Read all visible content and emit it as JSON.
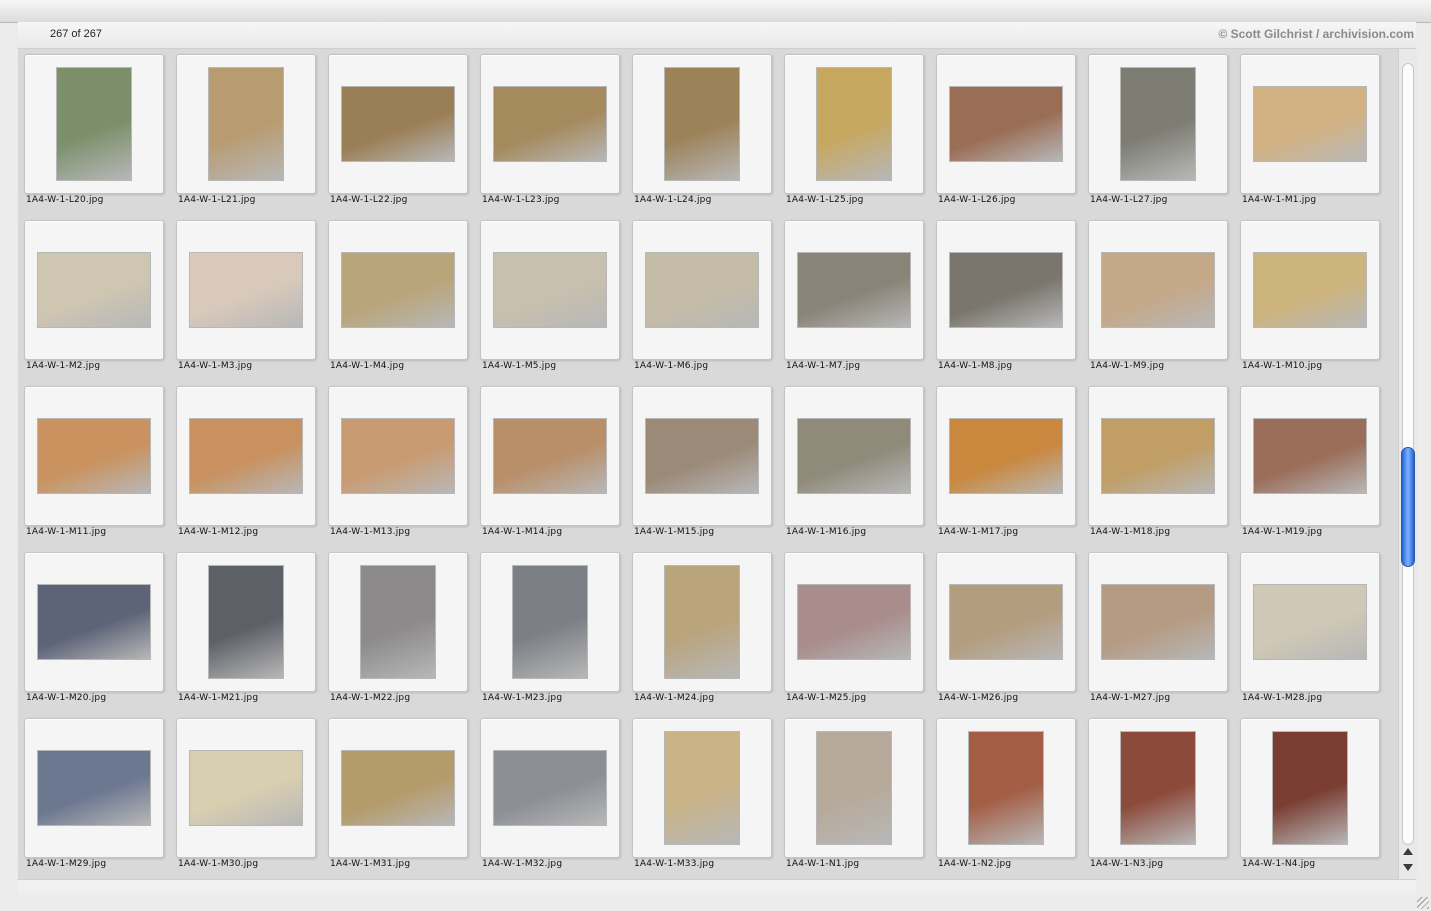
{
  "header": {
    "count": "267 of 267",
    "credit": "© Scott Gilchrist / archivision.com"
  },
  "thumbnails": [
    {
      "file": "1A4-W-1-L20.jpg",
      "orient": "portrait",
      "color": "#7a8f6a"
    },
    {
      "file": "1A4-W-1-L21.jpg",
      "orient": "portrait",
      "color": "#b89b70"
    },
    {
      "file": "1A4-W-1-L22.jpg",
      "orient": "landscape",
      "color": "#9a7e55"
    },
    {
      "file": "1A4-W-1-L23.jpg",
      "orient": "landscape",
      "color": "#a58a5e"
    },
    {
      "file": "1A4-W-1-L24.jpg",
      "orient": "portrait",
      "color": "#9c8259"
    },
    {
      "file": "1A4-W-1-L25.jpg",
      "orient": "portrait",
      "color": "#c6a75f"
    },
    {
      "file": "1A4-W-1-L26.jpg",
      "orient": "landscape",
      "color": "#9a6d55"
    },
    {
      "file": "1A4-W-1-L27.jpg",
      "orient": "portrait",
      "color": "#7d7d74"
    },
    {
      "file": "1A4-W-1-M1.jpg",
      "orient": "landscape",
      "color": "#d2b283"
    },
    {
      "file": "1A4-W-1-M2.jpg",
      "orient": "landscape",
      "color": "#cfc6b2"
    },
    {
      "file": "1A4-W-1-M3.jpg",
      "orient": "landscape",
      "color": "#d8c9bb"
    },
    {
      "file": "1A4-W-1-M4.jpg",
      "orient": "landscape",
      "color": "#b9a57a"
    },
    {
      "file": "1A4-W-1-M5.jpg",
      "orient": "landscape",
      "color": "#c8c0ae"
    },
    {
      "file": "1A4-W-1-M6.jpg",
      "orient": "landscape",
      "color": "#c5bca7"
    },
    {
      "file": "1A4-W-1-M7.jpg",
      "orient": "landscape",
      "color": "#8a8478"
    },
    {
      "file": "1A4-W-1-M8.jpg",
      "orient": "landscape",
      "color": "#7a766d"
    },
    {
      "file": "1A4-W-1-M9.jpg",
      "orient": "landscape",
      "color": "#c5a888"
    },
    {
      "file": "1A4-W-1-M10.jpg",
      "orient": "landscape",
      "color": "#cdb47d"
    },
    {
      "file": "1A4-W-1-M11.jpg",
      "orient": "landscape",
      "color": "#c9925f"
    },
    {
      "file": "1A4-W-1-M12.jpg",
      "orient": "landscape",
      "color": "#c8915f"
    },
    {
      "file": "1A4-W-1-M13.jpg",
      "orient": "landscape",
      "color": "#c99b72"
    },
    {
      "file": "1A4-W-1-M14.jpg",
      "orient": "landscape",
      "color": "#b98f6a"
    },
    {
      "file": "1A4-W-1-M15.jpg",
      "orient": "landscape",
      "color": "#9b8a78"
    },
    {
      "file": "1A4-W-1-M16.jpg",
      "orient": "landscape",
      "color": "#8f8a7a"
    },
    {
      "file": "1A4-W-1-M17.jpg",
      "orient": "landscape",
      "color": "#c9883e"
    },
    {
      "file": "1A4-W-1-M18.jpg",
      "orient": "landscape",
      "color": "#c09e66"
    },
    {
      "file": "1A4-W-1-M19.jpg",
      "orient": "landscape",
      "color": "#9b6e5a"
    },
    {
      "file": "1A4-W-1-M20.jpg",
      "orient": "landscape",
      "color": "#5d6478"
    },
    {
      "file": "1A4-W-1-M21.jpg",
      "orient": "portrait",
      "color": "#5e6068"
    },
    {
      "file": "1A4-W-1-M22.jpg",
      "orient": "portrait",
      "color": "#8c8a8a"
    },
    {
      "file": "1A4-W-1-M23.jpg",
      "orient": "portrait",
      "color": "#7c7f86"
    },
    {
      "file": "1A4-W-1-M24.jpg",
      "orient": "portrait",
      "color": "#b9a47c"
    },
    {
      "file": "1A4-W-1-M25.jpg",
      "orient": "landscape",
      "color": "#a88d8c"
    },
    {
      "file": "1A4-W-1-M26.jpg",
      "orient": "landscape",
      "color": "#b39d7f"
    },
    {
      "file": "1A4-W-1-M27.jpg",
      "orient": "landscape",
      "color": "#b59b84"
    },
    {
      "file": "1A4-W-1-M28.jpg",
      "orient": "landscape",
      "color": "#cfc8b6"
    },
    {
      "file": "1A4-W-1-M29.jpg",
      "orient": "landscape",
      "color": "#6c7790"
    },
    {
      "file": "1A4-W-1-M30.jpg",
      "orient": "landscape",
      "color": "#d8ceb0"
    },
    {
      "file": "1A4-W-1-M31.jpg",
      "orient": "landscape",
      "color": "#b59a6a"
    },
    {
      "file": "1A4-W-1-M32.jpg",
      "orient": "landscape",
      "color": "#8c8f96"
    },
    {
      "file": "1A4-W-1-M33.jpg",
      "orient": "portrait",
      "color": "#c9b387"
    },
    {
      "file": "1A4-W-1-N1.jpg",
      "orient": "portrait",
      "color": "#b7a99a"
    },
    {
      "file": "1A4-W-1-N2.jpg",
      "orient": "portrait",
      "color": "#a35e45"
    },
    {
      "file": "1A4-W-1-N3.jpg",
      "orient": "portrait",
      "color": "#8c4a3a"
    },
    {
      "file": "1A4-W-1-N4.jpg",
      "orient": "portrait",
      "color": "#7a3d32"
    }
  ]
}
